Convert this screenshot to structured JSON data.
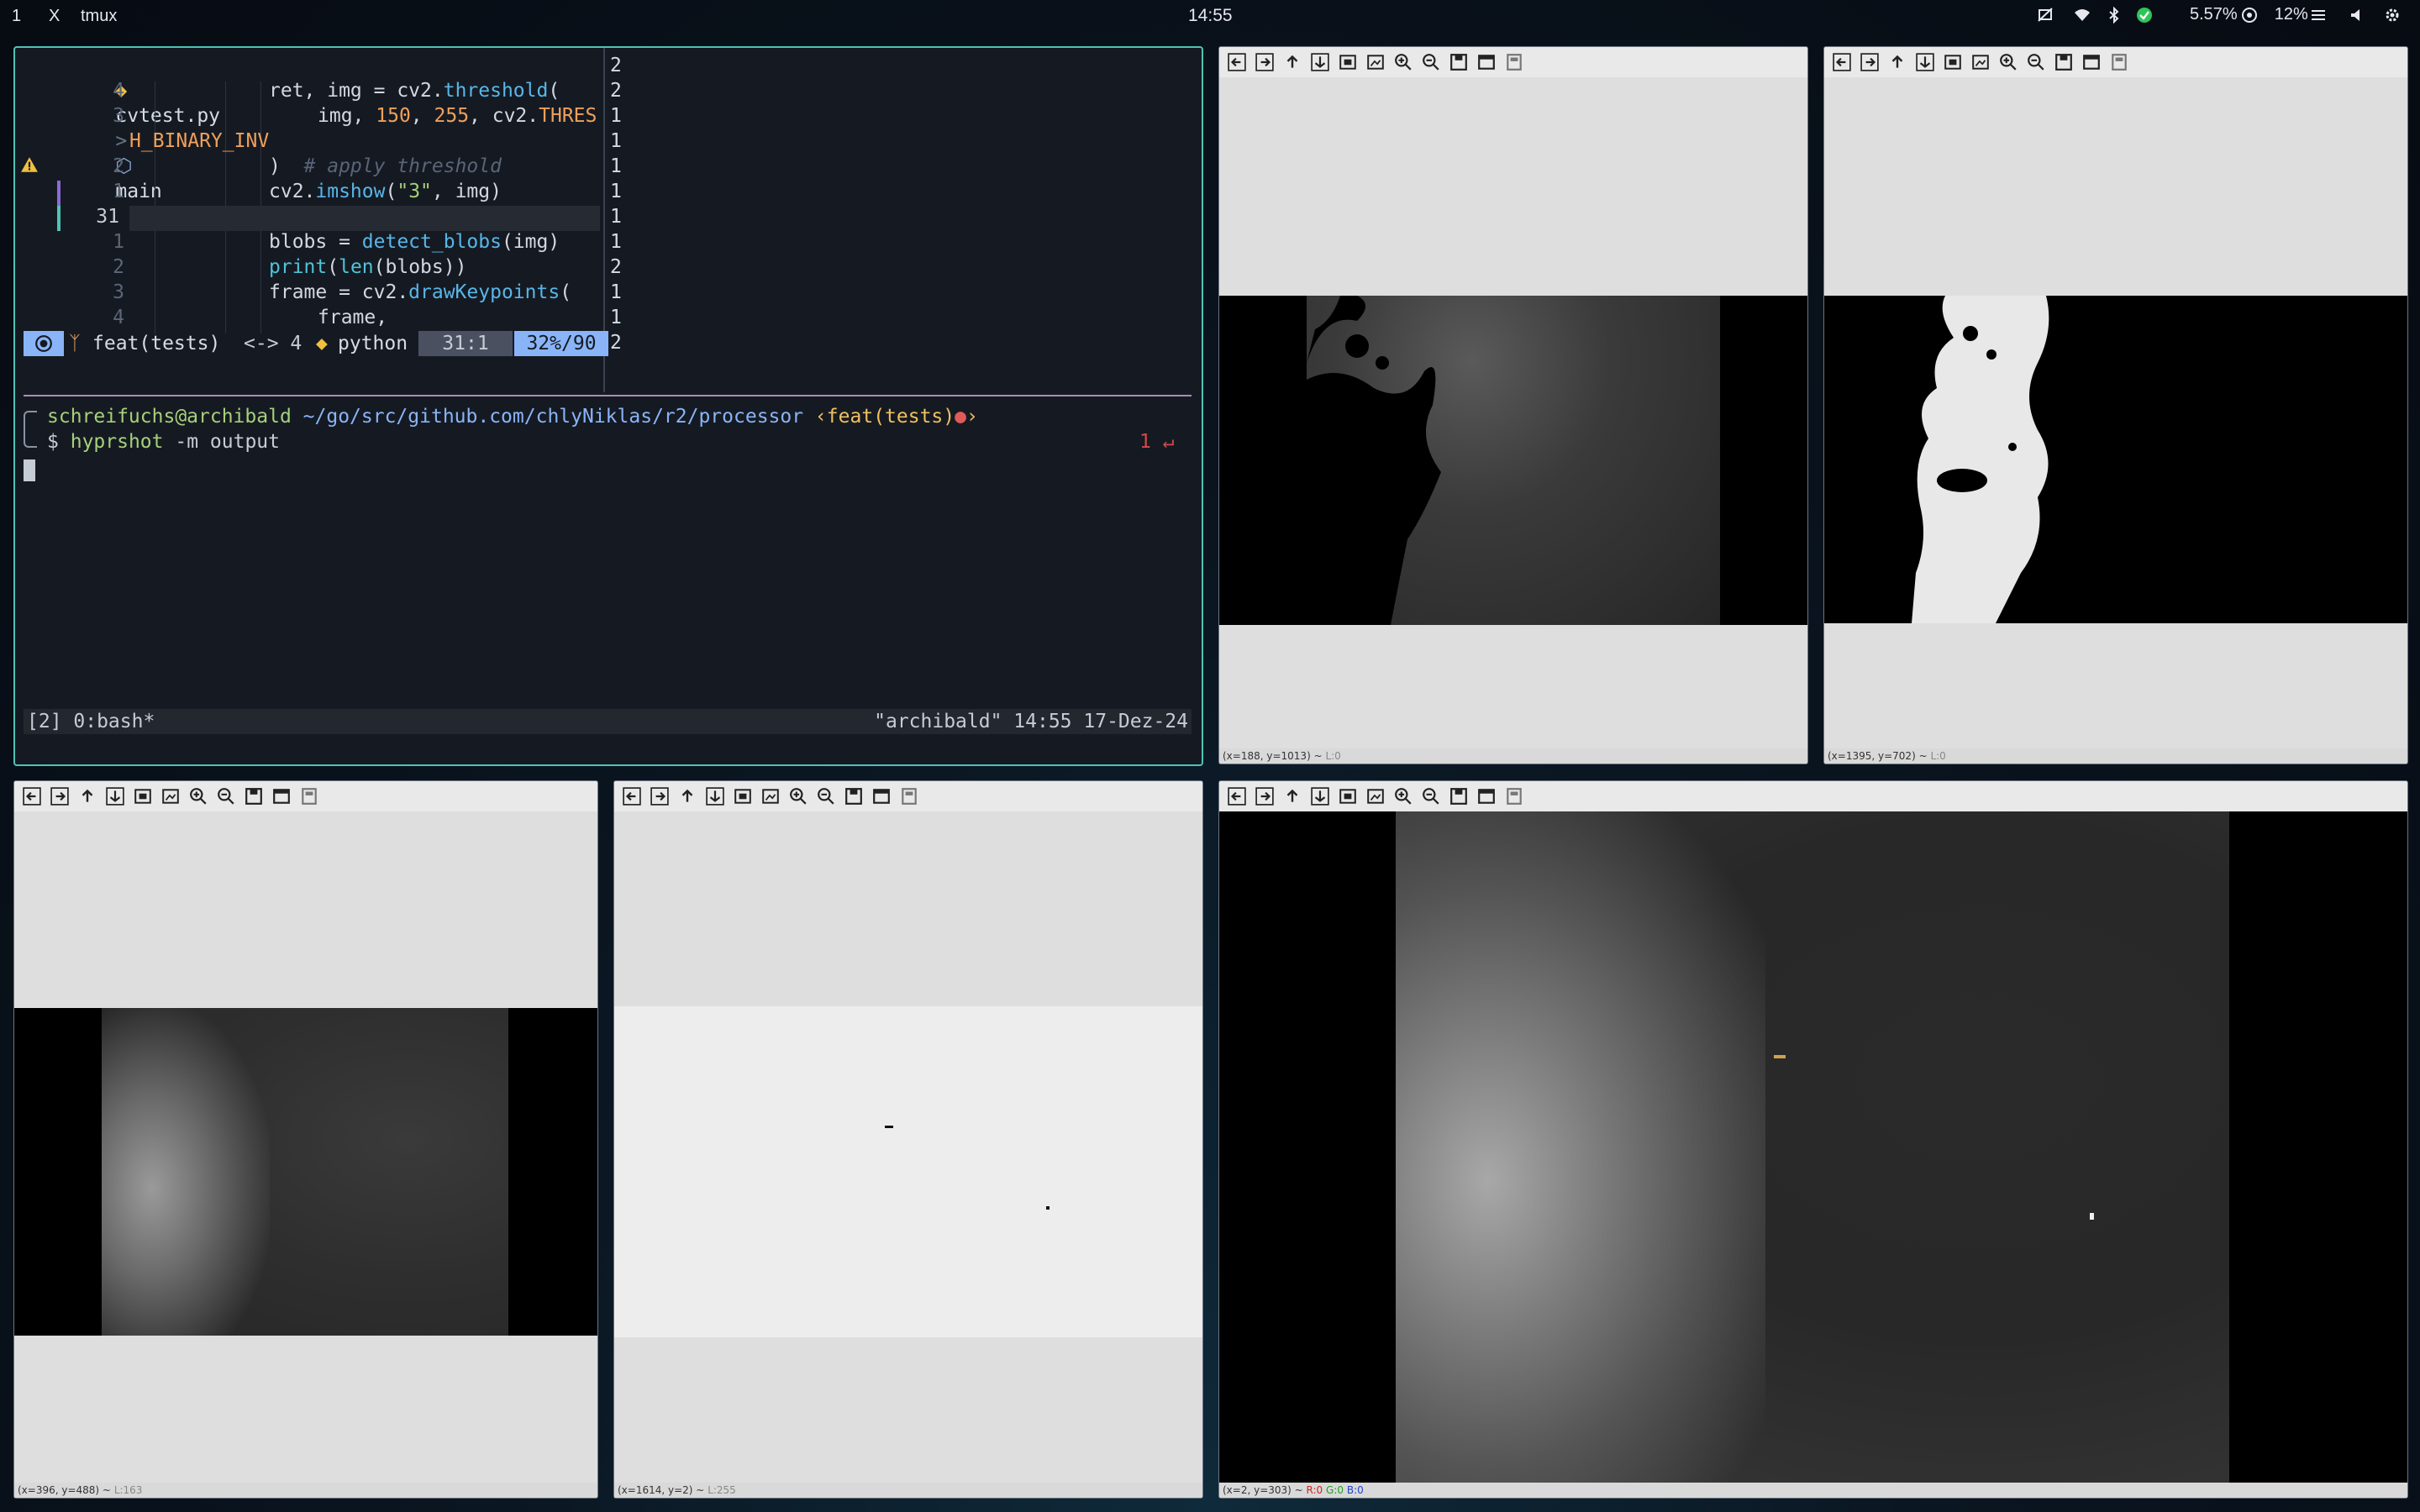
{
  "topbar": {
    "workspace": "1",
    "close": "X",
    "app": "tmux",
    "clock": "14:55",
    "battery": "5.57%",
    "volume": "12%"
  },
  "editor": {
    "filename": "cvtest.py",
    "separator": ">",
    "symbol": "main",
    "lines": [
      {
        "num": "4",
        "code": "ret, img = cv2.threshold("
      },
      {
        "num": "3",
        "code": "img, 150, 255, cv2.THRES"
      },
      {
        "num": "",
        "code": "H_BINARY_INV"
      },
      {
        "num": "2",
        "code": ")  # apply threshold"
      },
      {
        "num": "1",
        "code": "cv2.imshow(\"3\", img)"
      },
      {
        "num": "31",
        "code": ""
      },
      {
        "num": "1",
        "code": "blobs = detect_blobs(img)"
      },
      {
        "num": "2",
        "code": "print(len(blobs))"
      },
      {
        "num": "3",
        "code": "frame = cv2.drawKeypoints("
      },
      {
        "num": "4",
        "code": "frame,"
      }
    ],
    "right_counts": [
      "2",
      "2",
      "1",
      "1",
      "1",
      "1",
      "1",
      "1",
      "2",
      "1",
      "1",
      "2"
    ],
    "status": {
      "branch": "feat(tests)",
      "indent": "<-> 4",
      "language": "python",
      "position": "31:1",
      "percent": "32%/90"
    }
  },
  "shell": {
    "prompt_user": "schreifuchs@archibald",
    "prompt_path": "~/go/src/github.com/chlyNiklas/r2/processor",
    "prompt_branch": "‹feat(tests)",
    "prompt_end": "›",
    "dollar": "$",
    "command": "hyprshot",
    "args": "-m output",
    "exit_code": "1 ↵"
  },
  "tmux": {
    "left": "[2] 0:bash*",
    "right": "\"archibald\" 14:55 17-Dez-24"
  },
  "windows": [
    {
      "status": "(x=188, y=1013) ~",
      "extra": "L:0"
    },
    {
      "status": "(x=1395, y=702) ~",
      "extra": "L:0"
    },
    {
      "status": "(x=396, y=488) ~",
      "extra": "L:163"
    },
    {
      "status": "(x=1614, y=2) ~",
      "extra": "L:255"
    },
    {
      "status": "(x=2, y=303) ~",
      "r": "R:0",
      "g": "G:0",
      "b": "B:0"
    }
  ],
  "toolbar_icons": [
    "arrow-left-icon",
    "arrow-right-icon",
    "arrow-up-icon",
    "arrow-down-icon",
    "zoom-fit-icon",
    "zoom-original-icon",
    "zoom-in-icon",
    "zoom-out-icon",
    "save-icon",
    "properties-icon",
    "settings-icon"
  ]
}
